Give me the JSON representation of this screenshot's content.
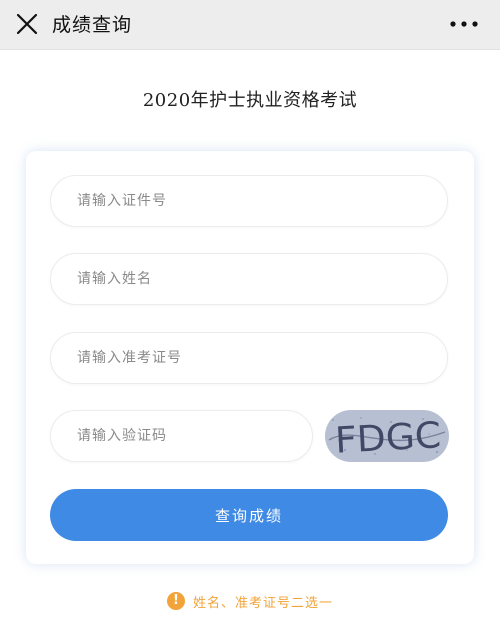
{
  "nav": {
    "title": "成绩查询",
    "close_icon": "close-icon",
    "more_icon": "more-icon"
  },
  "page_title": "2020年护士执业资格考试",
  "form": {
    "id_number": {
      "placeholder": "请输入证件号",
      "value": ""
    },
    "name": {
      "placeholder": "请输入姓名",
      "value": ""
    },
    "admission_number": {
      "placeholder": "请输入准考证号",
      "value": ""
    },
    "captcha": {
      "placeholder": "请输入验证码",
      "value": "",
      "image_text": "FDGC"
    },
    "submit_label": "查询成绩"
  },
  "hint": {
    "icon": "!",
    "text": "姓名、准考证号二选一"
  },
  "colors": {
    "primary": "#3f8ae4",
    "hint": "#f2a33a",
    "navbar": "#ededed"
  }
}
